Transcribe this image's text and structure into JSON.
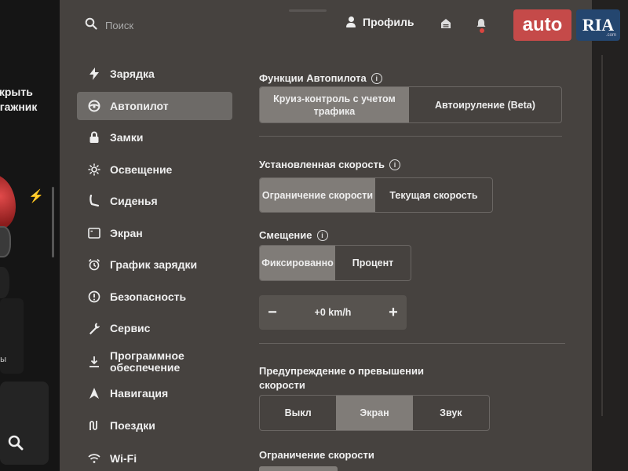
{
  "left_strip": {
    "open_trunk_line1": "ткрыть",
    "open_trunk_line2": "агажник",
    "mini_label": "ры"
  },
  "topbar": {
    "search_placeholder": "Поиск",
    "profile_label": "Профиль"
  },
  "watermark": {
    "auto": "auto",
    "ria": "RIA",
    "com": ".com"
  },
  "nav": {
    "items": [
      {
        "label": "Зарядка",
        "icon": "bolt-icon"
      },
      {
        "label": "Автопилот",
        "icon": "steering-wheel-icon",
        "active": true
      },
      {
        "label": "Замки",
        "icon": "lock-icon"
      },
      {
        "label": "Освещение",
        "icon": "sun-icon"
      },
      {
        "label": "Сиденья",
        "icon": "seat-icon"
      },
      {
        "label": "Экран",
        "icon": "display-icon"
      },
      {
        "label": "График зарядки",
        "icon": "alarm-clock-icon"
      },
      {
        "label": "Безопасность",
        "icon": "alert-circle-icon"
      },
      {
        "label": "Сервис",
        "icon": "wrench-icon"
      },
      {
        "label": "Программное обеспечение",
        "icon": "download-icon"
      },
      {
        "label": "Навигация",
        "icon": "navigation-arrow-icon"
      },
      {
        "label": "Поездки",
        "icon": "trips-icon"
      },
      {
        "label": "Wi-Fi",
        "icon": "wifi-icon"
      }
    ]
  },
  "content": {
    "autopilot_features": {
      "title": "Функции Автопилота",
      "options": [
        "Круиз-контроль с учетом трафика",
        "Автоируление (Beta)"
      ],
      "selected": 0
    },
    "set_speed": {
      "title": "Установленная скорость",
      "options": [
        "Ограничение скорости",
        "Текущая скорость"
      ],
      "selected": 0
    },
    "offset": {
      "title": "Смещение",
      "options": [
        "Фиксированно",
        "Процент"
      ],
      "selected": 0
    },
    "offset_stepper": {
      "value": "+0 km/h",
      "minus": "−",
      "plus": "+"
    },
    "speed_warning": {
      "title": "Предупреждение о превышении скорости",
      "options": [
        "Выкл",
        "Экран",
        "Звук"
      ],
      "selected": 1
    },
    "speed_limit": {
      "title": "Ограничение скорости"
    }
  },
  "colors": {
    "panel": "#46423f",
    "selected_option": "#807c78",
    "active_nav": "#6d6a67",
    "notification_dot": "#d9453f"
  }
}
